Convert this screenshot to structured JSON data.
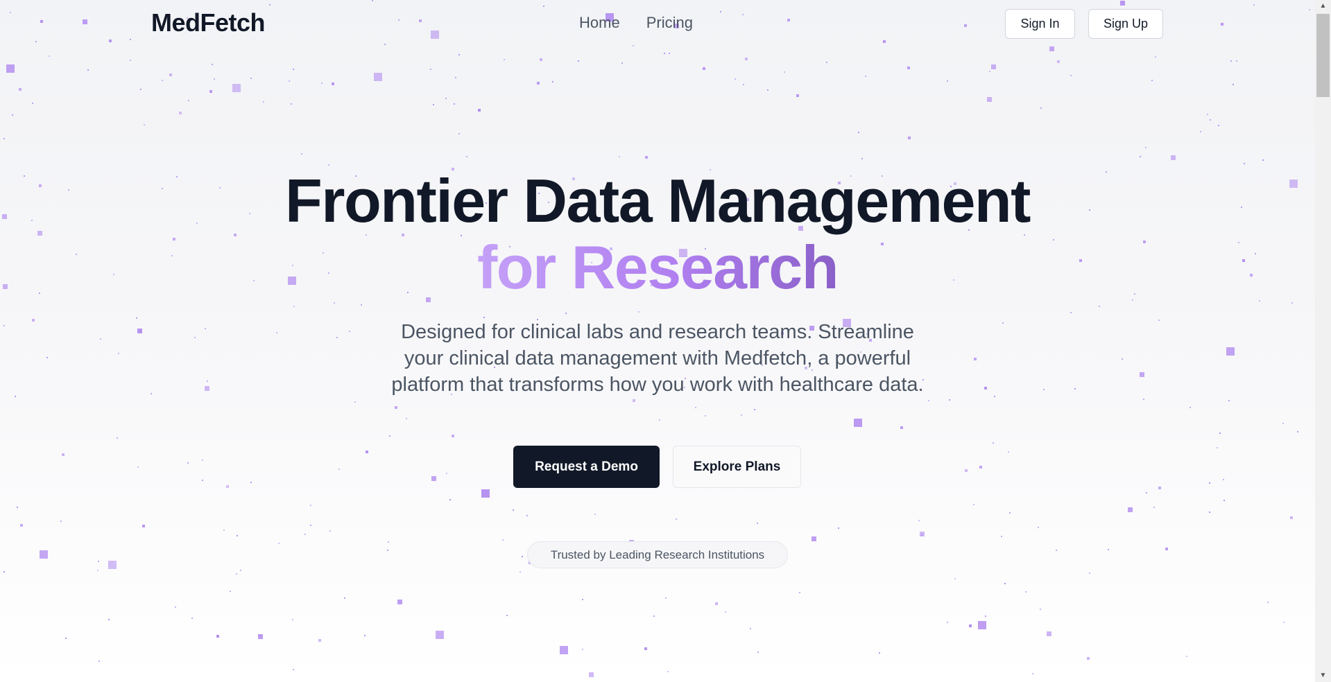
{
  "brand": {
    "name": "MedFetch"
  },
  "nav": {
    "links": [
      "Home",
      "Pricing"
    ],
    "sign_in": "Sign In",
    "sign_up": "Sign Up"
  },
  "hero": {
    "title_line1": "Frontier Data Management",
    "title_line2": "for Research",
    "subtitle": "Designed for clinical labs and research teams. Streamline your clinical data management with Medfetch, a powerful platform that transforms how you work with healthcare data.",
    "cta_primary": "Request a Demo",
    "cta_secondary": "Explore Plans",
    "trust_badge": "Trusted by Leading Research Institutions"
  },
  "colors": {
    "accent_gradient_start": "#c4a0f7",
    "accent_gradient_end": "#8a60c8",
    "particle": "#b48ef0",
    "primary_button": "#111827"
  },
  "scrollbar": {
    "up_icon": "▲",
    "down_icon": "▼"
  }
}
